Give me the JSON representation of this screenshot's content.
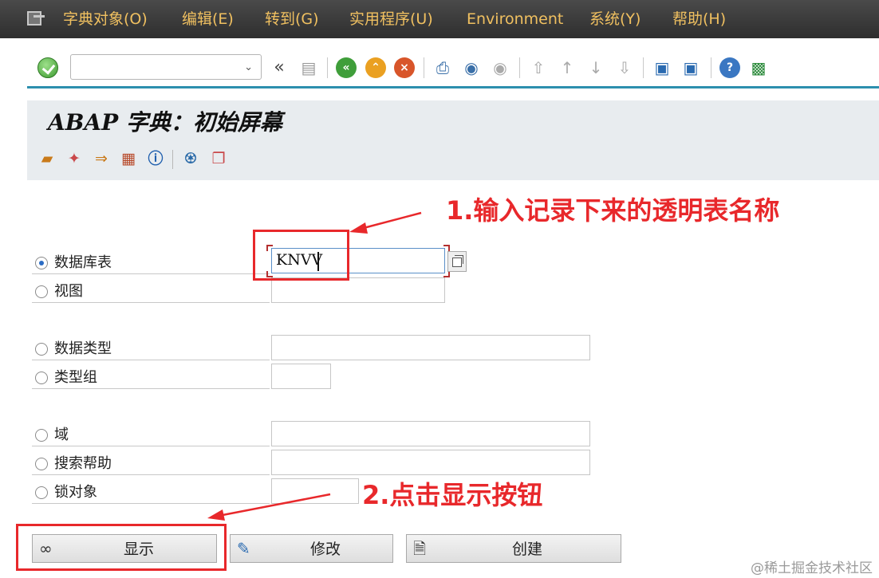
{
  "menubar": {
    "items": [
      "字典对象(O)",
      "编辑(E)",
      "转到(G)",
      "实用程序(U)",
      "Environment",
      "系统(Y)",
      "帮助(H)"
    ]
  },
  "toolbar": {
    "command_value": "",
    "back_chevron": "«",
    "icons": [
      "ok-icon",
      "save-icon",
      "back-icon",
      "exit-icon",
      "cancel-icon",
      "print-icon",
      "find-icon",
      "find-next-icon",
      "first-page-icon",
      "previous-page-icon",
      "next-page-icon",
      "last-page-icon",
      "new-session-icon",
      "shortcut-icon",
      "help-icon",
      "customize-layout-icon"
    ]
  },
  "title": "ABAP 字典：初始屏幕",
  "app_toolbar": {
    "icons": [
      "other-object-icon",
      "generate-icon",
      "copy-object-icon",
      "where-used-icon",
      "info-icon",
      "delete-icon",
      "copy-icon"
    ]
  },
  "form": {
    "options": [
      {
        "label": "数据库表",
        "selected": true,
        "value": "KNVV"
      },
      {
        "label": "视图",
        "selected": false,
        "value": ""
      },
      {
        "label": "数据类型",
        "selected": false,
        "value": ""
      },
      {
        "label": "类型组",
        "selected": false,
        "value": ""
      },
      {
        "label": "域",
        "selected": false,
        "value": ""
      },
      {
        "label": "搜索帮助",
        "selected": false,
        "value": ""
      },
      {
        "label": "锁对象",
        "selected": false,
        "value": ""
      }
    ]
  },
  "buttons": {
    "display": "显示",
    "change": "修改",
    "create": "创建"
  },
  "annotations": {
    "step1": "1.输入记录下来的透明表名称",
    "step2": "2.点击显示按钮",
    "accent_color": "#e8282b"
  },
  "watermark": "@稀土掘金技术社区"
}
